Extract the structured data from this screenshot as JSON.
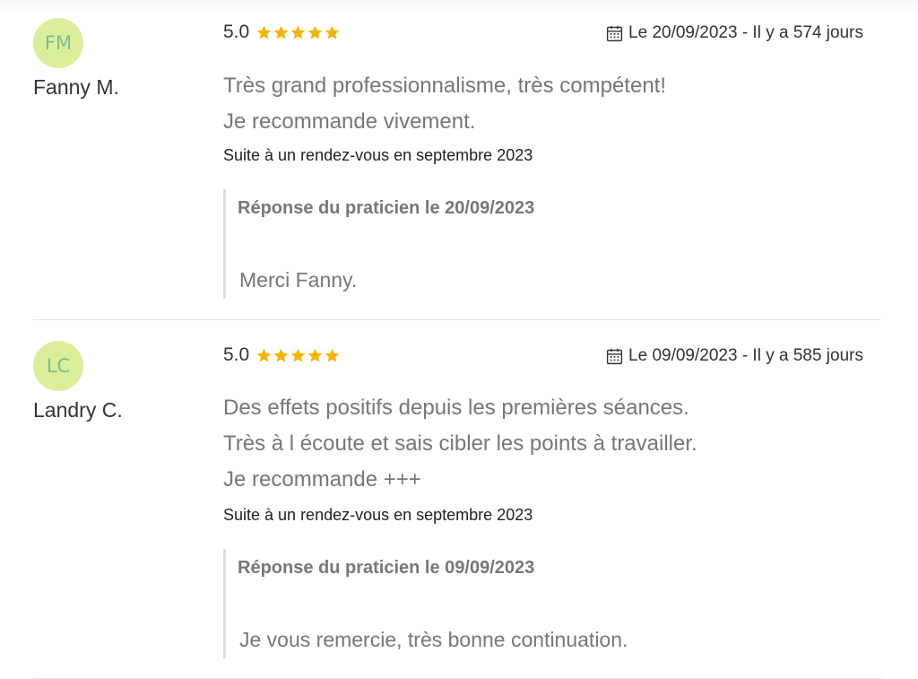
{
  "reviews": [
    {
      "initials": "FM",
      "author": "Fanny M.",
      "rating": "5.0",
      "stars": 5,
      "date": "Le 20/09/2023 - Il y a 574 jours",
      "lines": [
        "Très grand professionnalisme, très compétent!",
        "Je recommande vivement."
      ],
      "visit": "Suite à un rendez-vous en septembre 2023",
      "reply_title": "Réponse du praticien le 20/09/2023",
      "reply_text": "Merci Fanny."
    },
    {
      "initials": "LC",
      "author": "Landry C.",
      "rating": "5.0",
      "stars": 5,
      "date": "Le 09/09/2023 - Il y a 585 jours",
      "lines": [
        "Des effets positifs depuis les premières séances.",
        "Très à l écoute et sais cibler les points à travailler.",
        "Je recommande +++"
      ],
      "visit": "Suite à un rendez-vous en septembre 2023",
      "reply_title": "Réponse du praticien le 09/09/2023",
      "reply_text": "Je vous remercie, très bonne continuation."
    }
  ],
  "colors": {
    "star": "#f6b400",
    "avatar_bg": "#dbef9b",
    "avatar_text": "#7cbc8f"
  }
}
